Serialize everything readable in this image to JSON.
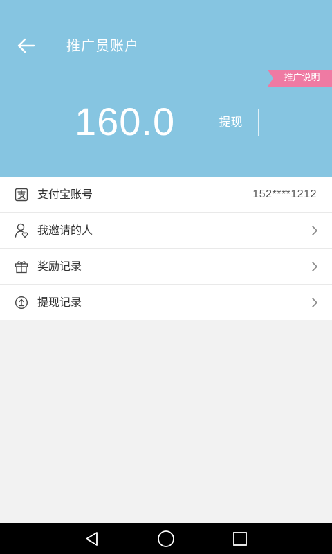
{
  "header": {
    "title": "推广员账户",
    "ribbon_label": "推广说明",
    "balance": "160.0",
    "withdraw_label": "提现",
    "bg_color": "#86c5e1",
    "ribbon_color": "#ef7aa3"
  },
  "list": {
    "items": [
      {
        "icon": "alipay-icon",
        "label": "支付宝账号",
        "value": "152****1212"
      },
      {
        "icon": "user-heart-icon",
        "label": "我邀请的人"
      },
      {
        "icon": "gift-icon",
        "label": "奖励记录"
      },
      {
        "icon": "withdraw-circle-icon",
        "label": "提现记录"
      }
    ]
  },
  "navbar": {
    "buttons": [
      "back-triangle-icon",
      "home-circle-icon",
      "recents-square-icon"
    ]
  }
}
